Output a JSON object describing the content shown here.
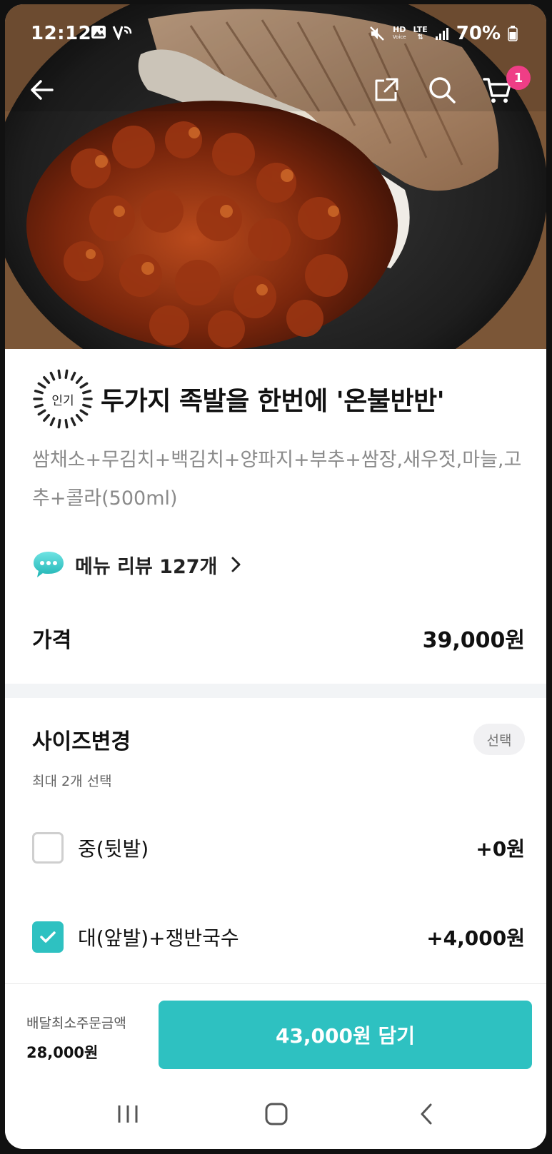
{
  "status_bar": {
    "time": "12:12",
    "battery": "70%",
    "network_hd": "HD",
    "network_voice": "Voice",
    "network_lte": "LTE"
  },
  "header": {
    "icons": [
      "back-arrow-icon",
      "share-icon",
      "search-icon",
      "cart-icon"
    ],
    "cart_count": "1"
  },
  "menu": {
    "badge": "인기",
    "title": "두가지 족발을 한번에 '온불반반'",
    "description": "쌈채소+무김치+백김치+양파지+부추+쌈장,새우젓,마늘,고추+콜라(500ml)",
    "review_label": "메뉴 리뷰 127개",
    "price_label": "가격",
    "price_value": "39,000원"
  },
  "options": {
    "section_title": "사이즈변경",
    "section_tag": "선택",
    "section_sub": "최대 2개 선택",
    "items": [
      {
        "label": "중(뒷발)",
        "price": "+0원",
        "checked": false
      },
      {
        "label": "대(앞발)+쟁반국수",
        "price": "+4,000원",
        "checked": true
      }
    ]
  },
  "bottom": {
    "min_order_label": "배달최소주문금액",
    "min_order_value": "28,000원",
    "cta_label": "43,000원 담기"
  },
  "colors": {
    "accent": "#2ec1c1",
    "badge": "#ef3e86"
  }
}
